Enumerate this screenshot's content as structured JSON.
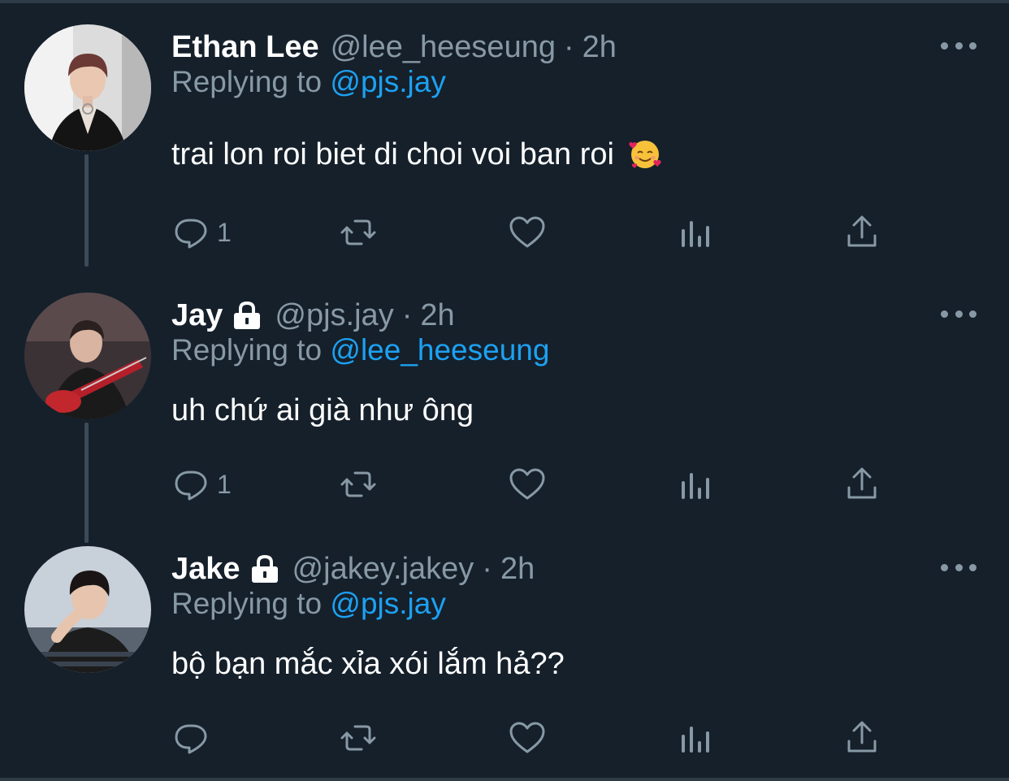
{
  "theme": {
    "background": "#15202b",
    "muted": "#8899a6",
    "accent": "#1da1f2",
    "text": "#ffffff"
  },
  "tweets": [
    {
      "name": "Ethan Lee",
      "handle": "@lee_heeseung",
      "separator": "·",
      "time": "2h",
      "locked": false,
      "replying_prefix": "Replying to",
      "replying_to": "@pjs.jay",
      "text": "trai lon roi biet di choi voi ban roi",
      "emoji": "smiling-face-with-hearts",
      "reply_count": "1",
      "avatar_icon": "avatar-photo"
    },
    {
      "name": "Jay",
      "handle": "@pjs.jay",
      "separator": "·",
      "time": "2h",
      "locked": true,
      "replying_prefix": "Replying to",
      "replying_to": "@lee_heeseung",
      "text": "uh chứ ai già như ông",
      "reply_count": "1",
      "avatar_icon": "avatar-photo"
    },
    {
      "name": "Jake",
      "handle": "@jakey.jakey",
      "separator": "·",
      "time": "2h",
      "locked": true,
      "replying_prefix": "Replying to",
      "replying_to": "@pjs.jay",
      "text": "bộ bạn mắc xỉa xói lắm hả??",
      "reply_count": "",
      "avatar_icon": "avatar-photo"
    }
  ],
  "action_icons": [
    "reply-icon",
    "retweet-icon",
    "like-icon",
    "analytics-icon",
    "share-icon"
  ]
}
